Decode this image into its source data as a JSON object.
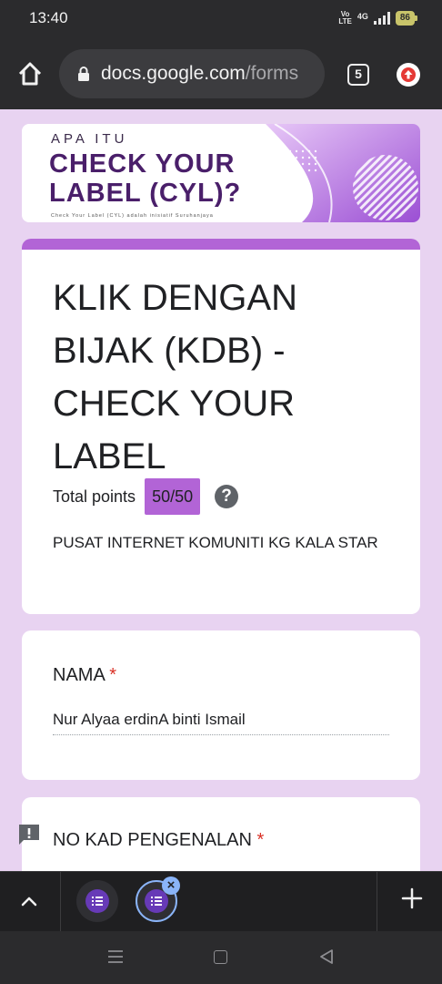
{
  "status_bar": {
    "time": "13:40",
    "volte": "Vo LTE",
    "network": "4G",
    "battery": "86"
  },
  "browser": {
    "url_domain": "docs.google.com",
    "url_path": "/forms",
    "tab_count": "5"
  },
  "banner": {
    "pre_title": "APA ITU",
    "title_line1": "CHECK YOUR",
    "title_line2": "LABEL (CYL)?",
    "small_text": "Check Your Label (CYL) adalah inisiatif Suruhanjaya"
  },
  "form": {
    "title": "KLIK DENGAN BIJAK (KDB) - CHECK YOUR LABEL",
    "points_label": "Total points",
    "points_value": "50/50",
    "help_glyph": "?",
    "description": "PUSAT INTERNET KOMUNITI KG KALA STAR"
  },
  "questions": [
    {
      "label": "NAMA",
      "required_mark": "*",
      "answer": "Nur Alyaa erdinA binti Ismail"
    },
    {
      "label": "NO KAD PENGENALAN",
      "required_mark": "*"
    }
  ],
  "tabbar": {
    "close_glyph": "×"
  },
  "colors": {
    "page_bg": "#e8d3f1",
    "accent": "#b264d6",
    "brand_dark": "#4a1f6a",
    "required": "#d93025",
    "forms_purple": "#673ab7",
    "tab_active": "#8ab4f8"
  },
  "icons": [
    "home-icon",
    "lock-icon",
    "tab-switcher-icon",
    "update-icon",
    "help-icon",
    "feedback-icon",
    "chevron-up-icon",
    "google-forms-icon",
    "close-icon",
    "plus-icon",
    "menu-icon",
    "square-home-icon",
    "back-triangle-icon"
  ]
}
